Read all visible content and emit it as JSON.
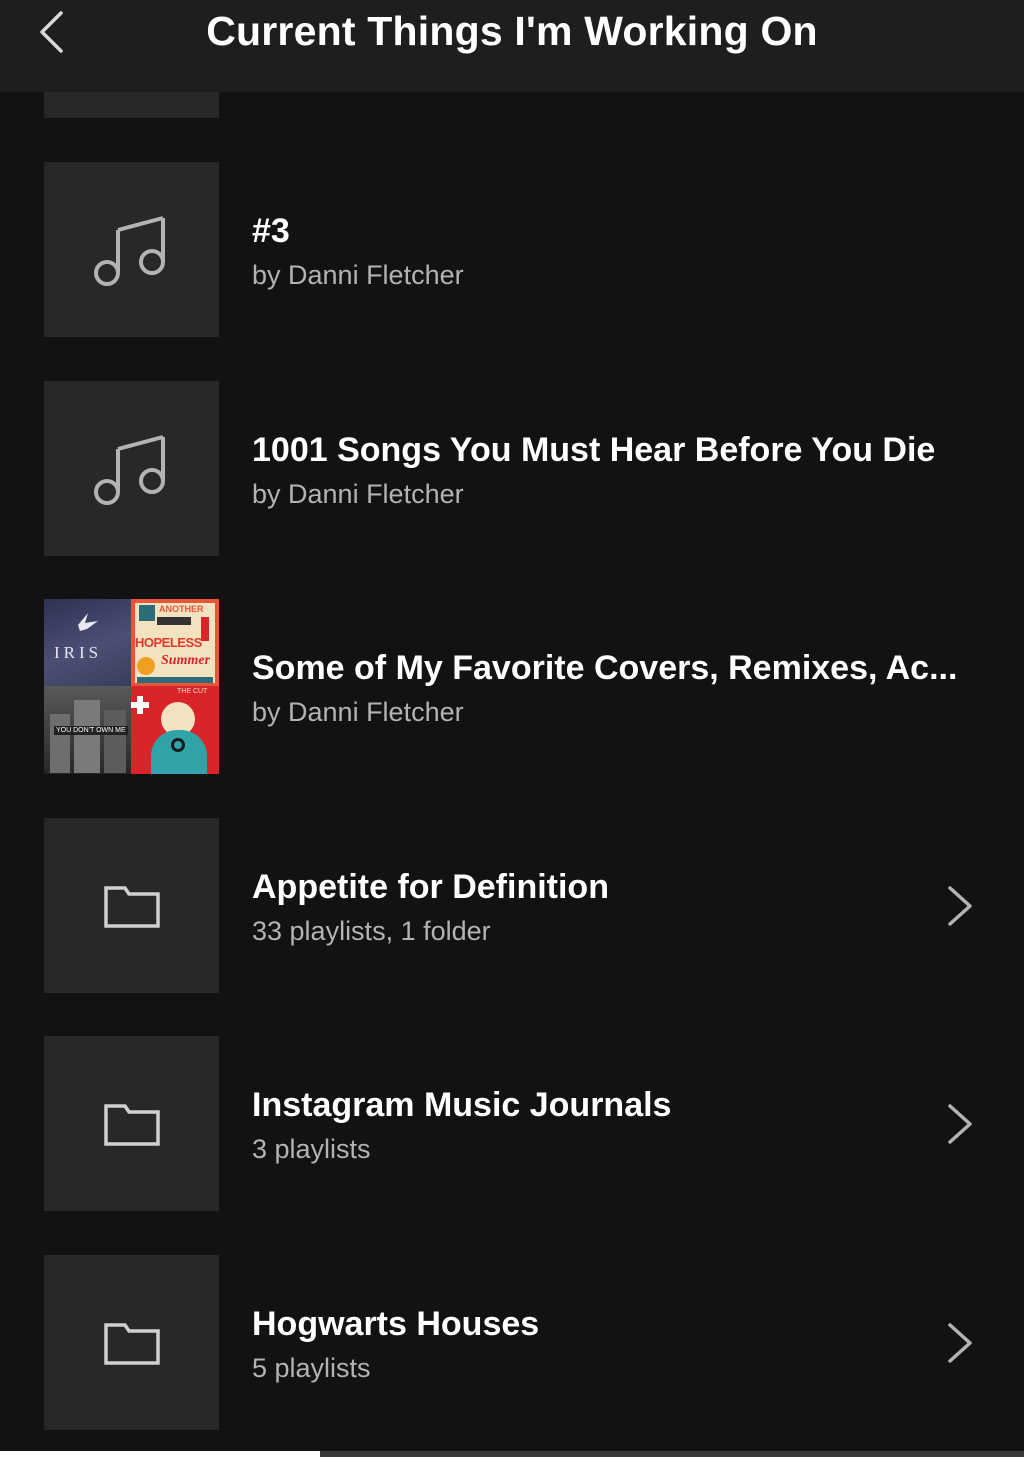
{
  "header": {
    "title": "Current Things I'm Working On",
    "back_icon": "chevron-left-icon"
  },
  "items": [
    {
      "type": "playlist",
      "title": "#3",
      "subtitle": "by Danni Fletcher",
      "icon": "music-note-icon"
    },
    {
      "type": "playlist",
      "title": "1001 Songs You Must Hear Before You Die",
      "subtitle": "by Danni Fletcher",
      "icon": "music-note-icon"
    },
    {
      "type": "playlist",
      "title": "Some of My Favorite Covers, Remixes, Ac...",
      "subtitle": "by Danni Fletcher",
      "icon": "album-mosaic",
      "mosaic": {
        "tile1_text": "IRIS",
        "tile2_text1": "ANOTHER",
        "tile2_text2": "HOPELESS",
        "tile2_text3": "Summer",
        "tile3_text": "YOU DON'T OWN ME",
        "tile4_text": "THE CUT"
      }
    },
    {
      "type": "folder",
      "title": "Appetite for Definition",
      "subtitle": "33 playlists, 1 folder",
      "icon": "folder-icon"
    },
    {
      "type": "folder",
      "title": "Instagram Music Journals",
      "subtitle": "3 playlists",
      "icon": "folder-icon"
    },
    {
      "type": "folder",
      "title": "Hogwarts Houses",
      "subtitle": "5 playlists",
      "icon": "folder-icon"
    }
  ],
  "colors": {
    "background": "#121212",
    "header_background": "#1e1e1e",
    "tile_background": "#282828",
    "title_text": "#ffffff",
    "subtitle_text": "#b3b3b3"
  }
}
